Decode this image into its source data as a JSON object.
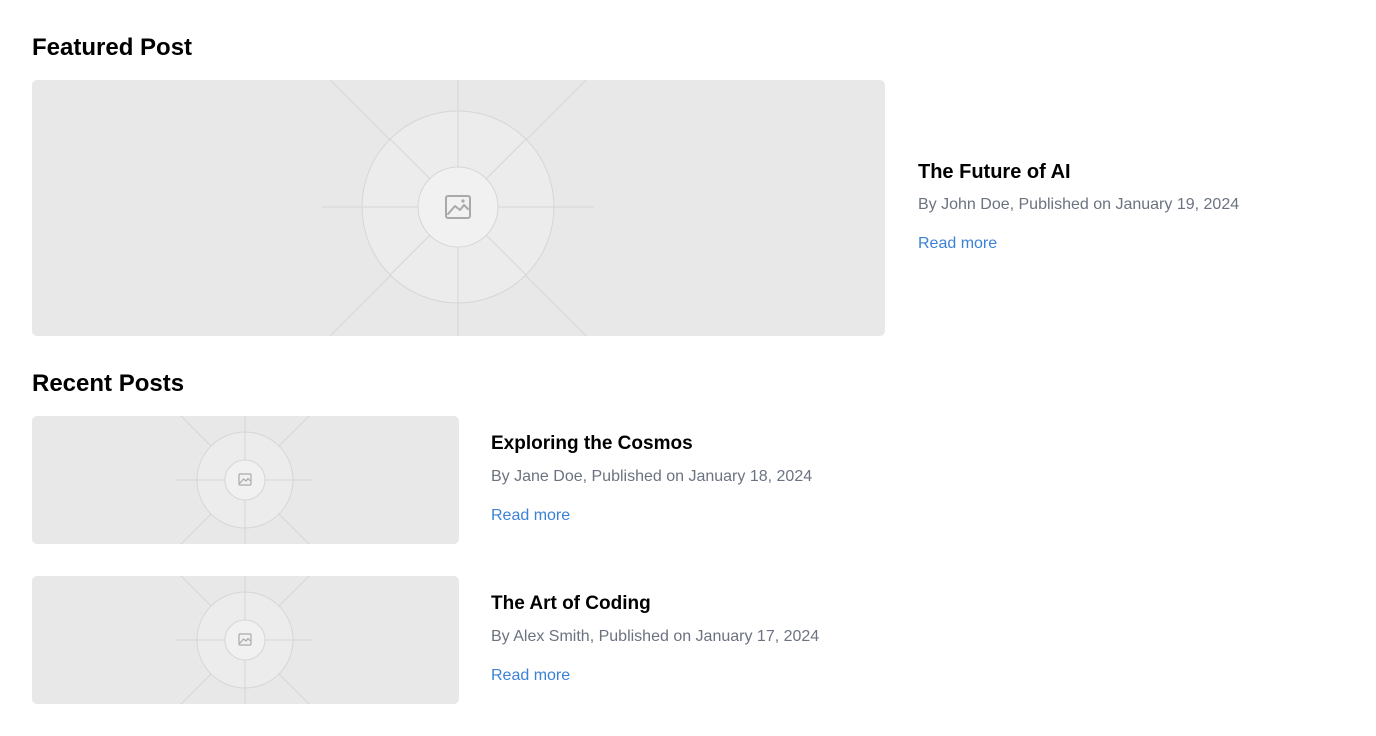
{
  "featured": {
    "heading": "Featured Post",
    "post": {
      "title": "The Future of AI",
      "meta": "By John Doe, Published on January 19, 2024",
      "link_label": "Read more",
      "image_icon": "image-placeholder-icon"
    }
  },
  "recent": {
    "heading": "Recent Posts",
    "posts": [
      {
        "title": "Exploring the Cosmos",
        "meta": "By Jane Doe, Published on January 18, 2024",
        "link_label": "Read more",
        "image_icon": "image-placeholder-icon"
      },
      {
        "title": "The Art of Coding",
        "meta": "By Alex Smith, Published on January 17, 2024",
        "link_label": "Read more",
        "image_icon": "image-placeholder-icon"
      }
    ]
  },
  "colors": {
    "background": "#ffffff",
    "placeholder": "#e8e8e8",
    "meta_text": "#6b7280",
    "link": "#3b82d6"
  }
}
